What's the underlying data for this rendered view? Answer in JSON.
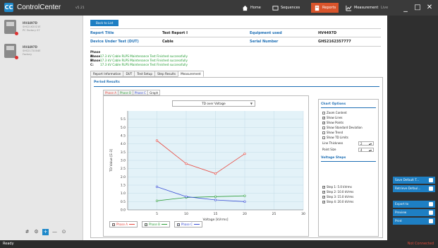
{
  "app": {
    "logo_glyph": "CC",
    "title": "ControlCenter",
    "version": "v5.21"
  },
  "nav": [
    {
      "label": "Home",
      "icon": "home-icon"
    },
    {
      "label": "Sequences",
      "icon": "sequences-icon"
    },
    {
      "label": "Reports",
      "icon": "reports-icon",
      "active": true
    },
    {
      "label": "Measurement",
      "icon": "measurement-icon"
    },
    {
      "label": "Live",
      "icon": ""
    }
  ],
  "window_controls": {
    "minimize": "_",
    "maximize": "□",
    "close": "✕"
  },
  "sidebar": {
    "devices": [
      {
        "name": "HV4497D",
        "sub1": "SHS2162021E",
        "sub2": "PC Factory 07"
      },
      {
        "name": "HV4497D",
        "sub1": "SHS2172004E",
        "sub2": "Factory"
      }
    ],
    "tools": [
      "#",
      "⚙",
      "+",
      "—",
      "⊙"
    ]
  },
  "main": {
    "back_label": "Back to List",
    "report_title_key": "Report Title",
    "report_title_val": "Test Report I",
    "equipment_key": "Equipment used",
    "equipment_val": "HV4497D",
    "dut_key": "Device Under Test (DUT)",
    "dut_val": "Cable",
    "serial_key": "Serial Number",
    "serial_val": "GHS2162357777",
    "phases": [
      {
        "key": "Phase A:",
        "msg": "17.3 kV Cable RLPS Maintenance Test Finished successfully"
      },
      {
        "key": "Phase B:",
        "msg": "17.3 kV Cable RLPS Maintenance Test Finished successfully"
      },
      {
        "key": "Phase C:",
        "msg": "17.3 kV Cable RLPS Maintenance Test Finished successfully"
      }
    ],
    "tabs": [
      "Report Information",
      "DUT",
      "Test Setup",
      "Step Results",
      "Measurement"
    ],
    "period_results": "Period Results",
    "subtabs": [
      "Phase A",
      "Phase B",
      "Phase C",
      "Graph"
    ],
    "dropdown": "TD over Voltage",
    "legend": [
      "Phase A",
      "Phase B",
      "Phase C"
    ]
  },
  "chart_options": {
    "title": "Chart Options",
    "options": [
      {
        "label": "Zoom Content",
        "checked": false
      },
      {
        "label": "Show Lines",
        "checked": true
      },
      {
        "label": "Show Points",
        "checked": true
      },
      {
        "label": "Show Standard Deviation",
        "checked": false
      },
      {
        "label": "Show Trend",
        "checked": false
      },
      {
        "label": "Show TD Limits",
        "checked": false
      }
    ],
    "line_thickness_label": "Line Thickness",
    "line_thickness_val": "2",
    "point_size_label": "Point Size",
    "point_size_val": "4",
    "voltage_steps_title": "Voltage Steps",
    "steps": [
      {
        "label": "Step 1: 5.0 kVrms",
        "checked": true
      },
      {
        "label": "Step 2: 10.0 kVrms",
        "checked": true
      },
      {
        "label": "Step 3: 15.0 kVrms",
        "checked": true
      },
      {
        "label": "Step 4: 20.0 kVrms",
        "checked": true
      }
    ]
  },
  "right_actions": [
    {
      "label": "Save Default T..."
    },
    {
      "label": "Retrieve Defaul..."
    },
    {
      "label": "Export to"
    },
    {
      "label": "Preview"
    },
    {
      "label": "Print"
    }
  ],
  "status": {
    "left": "Ready",
    "right": "Not Connected"
  },
  "chart_data": {
    "type": "line",
    "title": "",
    "xlabel": "Voltage [kVrms]",
    "ylabel": "TD Value [E-3]",
    "xlim": [
      0,
      30
    ],
    "ylim": [
      0,
      6
    ],
    "xticks": [
      5,
      10,
      15,
      20,
      25,
      30
    ],
    "yticks": [
      "0.0",
      "0.5",
      "1.0",
      "1.5",
      "2.0",
      "2.5",
      "3.0",
      "3.5",
      "4.0",
      "4.5",
      "5.0",
      "5.5"
    ],
    "ytick_vals": [
      0,
      0.5,
      1,
      1.5,
      2,
      2.5,
      3,
      3.5,
      4,
      4.5,
      5,
      5.5
    ],
    "x": [
      5,
      10,
      15,
      20
    ],
    "series": [
      {
        "name": "Phase A",
        "color": "#e8473e",
        "values": [
          4.2,
          2.8,
          2.2,
          3.4
        ]
      },
      {
        "name": "Phase B",
        "color": "#2e9e3a",
        "values": [
          0.55,
          0.75,
          0.8,
          0.85
        ]
      },
      {
        "name": "Phase C",
        "color": "#3a4fd6",
        "values": [
          1.4,
          0.8,
          0.6,
          0.5
        ]
      }
    ],
    "grid": true
  }
}
